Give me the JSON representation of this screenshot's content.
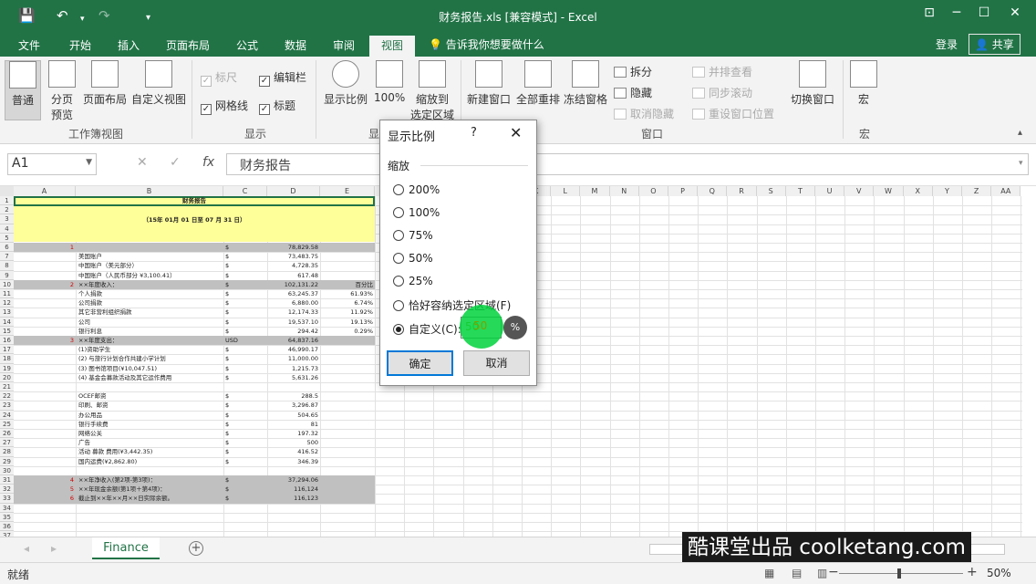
{
  "window": {
    "title": "财务报告.xls  [兼容模式] - Excel",
    "minimize": "─",
    "maximize": "☐",
    "close": "✕",
    "ribbon_options": "⊡"
  },
  "quick_access": {
    "save": "💾",
    "undo": "↶",
    "redo": "↷",
    "customize": "▾"
  },
  "tabs": [
    "文件",
    "开始",
    "插入",
    "页面布局",
    "公式",
    "数据",
    "审阅",
    "视图"
  ],
  "active_tab": "视图",
  "tell_me": "告诉我你想要做什么",
  "account": {
    "login": "登录",
    "share": "共享"
  },
  "ribbon": {
    "workbook_views": {
      "label": "工作簿视图",
      "normal": "普通",
      "page_break_1": "分页",
      "page_break_2": "预览",
      "page_layout": "页面布局",
      "custom_views": "自定义视图"
    },
    "show": {
      "label": "显示",
      "ruler": "标尺",
      "formula_bar": "编辑栏",
      "gridlines": "网格线",
      "headings": "标题"
    },
    "zoom": {
      "label": "显",
      "zoom": "显示比例",
      "zoom100": "100%",
      "zoom_sel_1": "缩放到",
      "zoom_sel_2": "选定区域"
    },
    "window": {
      "label": "窗口",
      "new_window": "新建窗口",
      "arrange_all": "全部重排",
      "freeze_panes": "冻结窗格",
      "split": "拆分",
      "hide": "隐藏",
      "unhide": "取消隐藏",
      "side_by_side": "并排查看",
      "sync_scroll": "同步滚动",
      "reset_position": "重设窗口位置",
      "switch_windows": "切换窗口"
    },
    "macros": {
      "label": "宏",
      "macros": "宏"
    }
  },
  "formula_bar": {
    "name_box": "A1",
    "cancel": "✕",
    "enter": "✓",
    "fx": "fx",
    "content": "财务报告"
  },
  "columns": [
    "A",
    "B",
    "C",
    "D",
    "E",
    "F",
    "G",
    "H",
    "I",
    "J",
    "K",
    "L",
    "M",
    "N",
    "O",
    "P",
    "Q",
    "R",
    "S",
    "T",
    "U",
    "V",
    "W",
    "X",
    "Y",
    "Z",
    "AA"
  ],
  "rows": [
    "1",
    "2",
    "3",
    "4",
    "5",
    "6",
    "7",
    "8",
    "9",
    "10",
    "11",
    "12",
    "13",
    "14",
    "15",
    "16",
    "17",
    "18",
    "19",
    "20",
    "21",
    "22",
    "23",
    "24",
    "25",
    "26",
    "27",
    "28",
    "29",
    "30",
    "31",
    "32",
    "33",
    "34",
    "35",
    "36",
    "37"
  ],
  "sheet": {
    "title": "财务报告",
    "period": "（15年 01月 01 日至 07 月 31 日）",
    "rows": [
      {
        "r": 6,
        "num": "1",
        "b": "",
        "c": "$",
        "d": "78,829.58",
        "e": "",
        "band": true
      },
      {
        "r": 7,
        "num": "",
        "b": "美国账户",
        "c": "$",
        "d": "73,483.75",
        "e": ""
      },
      {
        "r": 8,
        "num": "",
        "b": "中国账户（美元部分）",
        "c": "$",
        "d": "4,728.35",
        "e": ""
      },
      {
        "r": 9,
        "num": "",
        "b": "中国账户（人民币部分 ¥3,100.41）",
        "c": "$",
        "d": "617.48",
        "e": ""
      },
      {
        "r": 10,
        "num": "2",
        "b": "××年度收入：",
        "c": "$",
        "d": "102,131.22",
        "e": "百分比",
        "band": true
      },
      {
        "r": 11,
        "num": "",
        "b": "个人捐款",
        "c": "$",
        "d": "63,245.37",
        "e": "61.93%"
      },
      {
        "r": 12,
        "num": "",
        "b": "公司捐款",
        "c": "$",
        "d": "6,880.00",
        "e": "6.74%"
      },
      {
        "r": 13,
        "num": "",
        "b": "其它非营利组织捐款",
        "c": "$",
        "d": "12,174.33",
        "e": "11.92%"
      },
      {
        "r": 14,
        "num": "",
        "b": "公司",
        "c": "$",
        "d": "19,537.10",
        "e": "19.13%"
      },
      {
        "r": 15,
        "num": "",
        "b": "银行利息",
        "c": "$",
        "d": "294.42",
        "e": "0.29%"
      },
      {
        "r": 16,
        "num": "3",
        "b": "××年度支出：",
        "c": "USD",
        "d": "64,837.16",
        "e": "",
        "band": true
      },
      {
        "r": 17,
        "num": "",
        "b": "(1)资助学生",
        "c": "$",
        "d": "46,990.17",
        "e": ""
      },
      {
        "r": 18,
        "num": "",
        "b": "(2) 与旅行计划合作共建小学计划",
        "c": "$",
        "d": "11,000.00",
        "e": ""
      },
      {
        "r": 19,
        "num": "",
        "b": "(3) 图书馆项目(¥10,047.51)",
        "c": "$",
        "d": "1,215.73",
        "e": ""
      },
      {
        "r": 20,
        "num": "",
        "b": "(4) 基金会募款活动及其它运作费用",
        "c": "$",
        "d": "5,631.26",
        "e": ""
      },
      {
        "r": 22,
        "num": "",
        "b": "OCEF邮资",
        "c": "$",
        "d": "288.5",
        "e": ""
      },
      {
        "r": 23,
        "num": "",
        "b": "印刷、邮资",
        "c": "$",
        "d": "3,296.87",
        "e": ""
      },
      {
        "r": 24,
        "num": "",
        "b": "办公用品",
        "c": "$",
        "d": "504.65",
        "e": ""
      },
      {
        "r": 25,
        "num": "",
        "b": "银行手续费",
        "c": "$",
        "d": "81",
        "e": ""
      },
      {
        "r": 26,
        "num": "",
        "b": "网络公关",
        "c": "$",
        "d": "197.32",
        "e": ""
      },
      {
        "r": 27,
        "num": "",
        "b": "广告",
        "c": "$",
        "d": "500",
        "e": ""
      },
      {
        "r": 28,
        "num": "",
        "b": "活动 募款 费用(¥3,442.35)",
        "c": "$",
        "d": "416.52",
        "e": ""
      },
      {
        "r": 29,
        "num": "",
        "b": "国内运费(¥2,862.80)",
        "c": "$",
        "d": "346.39",
        "e": ""
      },
      {
        "r": 31,
        "num": "4",
        "b": "××年净收入(第2项-第3项)：",
        "c": "$",
        "d": "37,294.06",
        "e": "",
        "band": true
      },
      {
        "r": 32,
        "num": "5",
        "b": "××年现金余额(第1项＋第4项)：",
        "c": "$",
        "d": "116,124",
        "e": "",
        "band": true
      },
      {
        "r": 33,
        "num": "6",
        "b": "截止到××年××月××日实际余额。",
        "c": "$",
        "d": "116,123",
        "e": "",
        "band": true
      }
    ]
  },
  "dialog": {
    "title": "显示比例",
    "help": "?",
    "close": "✕",
    "group": "缩放",
    "options": [
      "200%",
      "100%",
      "75%",
      "50%",
      "25%",
      "恰好容纳选定区域(F)",
      "自定义(C):"
    ],
    "selected": "自定义(C):",
    "custom_value": "50",
    "percent": "%",
    "ok": "确定",
    "cancel": "取消"
  },
  "sheet_tabs": {
    "active": "Finance",
    "add": "+",
    "prev": "◂",
    "next": "▸"
  },
  "watermark": "酷课堂出品 coolketang.com",
  "status": {
    "ready": "就绪",
    "zoom": "50%",
    "zoom_minus": "−",
    "zoom_plus": "+"
  },
  "colors": {
    "accent": "#217346",
    "highlight": "#00d23c",
    "band": "#c0c0c0",
    "title_fill": "#ffff99"
  }
}
